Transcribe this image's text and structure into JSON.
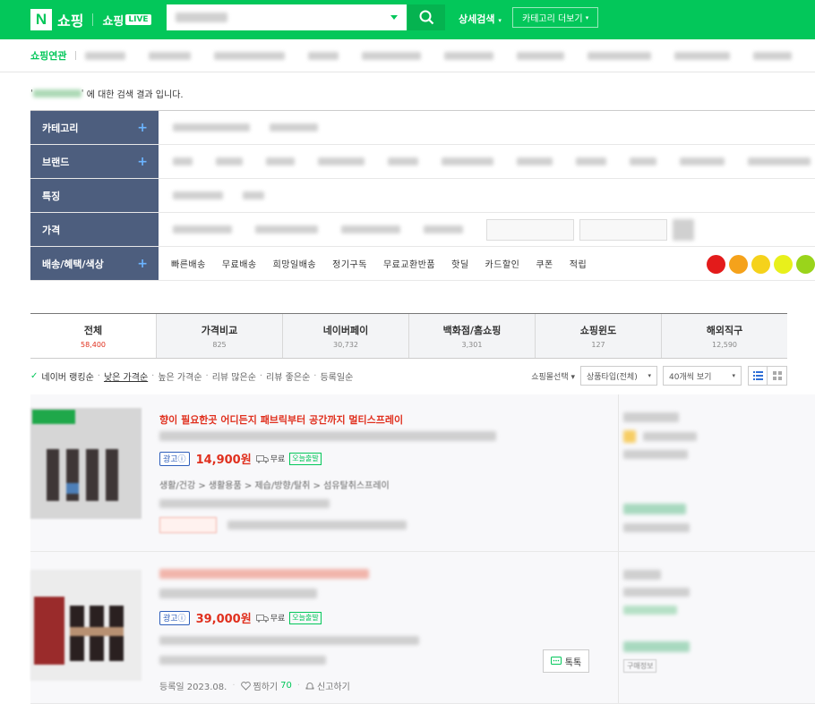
{
  "header": {
    "logo_letter": "N",
    "logo_text": "쇼핑",
    "live_text": "쇼핑",
    "live_badge": "LIVE",
    "search_value": "",
    "detail_search": "상세검색",
    "category_more": "카테고리 더보기"
  },
  "related": {
    "label": "쇼핑연관"
  },
  "result_suffix": "에 대한 검색 결과 입니다.",
  "filters": {
    "category": "카테고리",
    "brand": "브랜드",
    "feature": "특징",
    "price": "가격",
    "delivery": "배송/혜택/색상",
    "delivery_options": [
      "빠른배송",
      "무료배송",
      "희망일배송",
      "정기구독",
      "무료교환반품",
      "핫딜",
      "카드할인",
      "쿠폰",
      "적립"
    ],
    "colors": [
      "#e31b1b",
      "#f5a21b",
      "#f5d21b",
      "#e8f01b",
      "#9ad41b"
    ]
  },
  "tabs": [
    {
      "name": "전체",
      "count": "58,400"
    },
    {
      "name": "가격비교",
      "count": "825"
    },
    {
      "name": "네이버페이",
      "count": "30,732"
    },
    {
      "name": "백화점/홈쇼핑",
      "count": "3,301"
    },
    {
      "name": "쇼핑윈도",
      "count": "127"
    },
    {
      "name": "해외직구",
      "count": "12,590"
    }
  ],
  "sort": {
    "ranking": "네이버 랭킹순",
    "low_price": "낮은 가격순",
    "high_price": "높은 가격순",
    "review_many": "리뷰 많은순",
    "review_good": "리뷰 좋은순",
    "registered": "등록일순",
    "mall_select": "쇼핑몰선택",
    "product_type": "상품타입(전체)",
    "per_page": "40개씩 보기"
  },
  "items": [
    {
      "headline": "향이 필요한곳 어디든지 패브릭부터 공간까지 멀티스프레이",
      "ad": "광고ⓘ",
      "price": "14,900원",
      "delivery": "무료",
      "today": "오늘출발",
      "category_path": "생활/건강 > 생활용품 > 제습/방향/탈취 > 섬유탈취스프레이"
    },
    {
      "ad": "광고ⓘ",
      "price": "39,000원",
      "delivery": "무료",
      "today": "오늘출발",
      "registered": "등록일 2023.08.",
      "zzim": "찜하기",
      "zzim_count": "70",
      "report": "신고하기",
      "talk": "톡톡",
      "mall_tag": "구매정보"
    }
  ]
}
